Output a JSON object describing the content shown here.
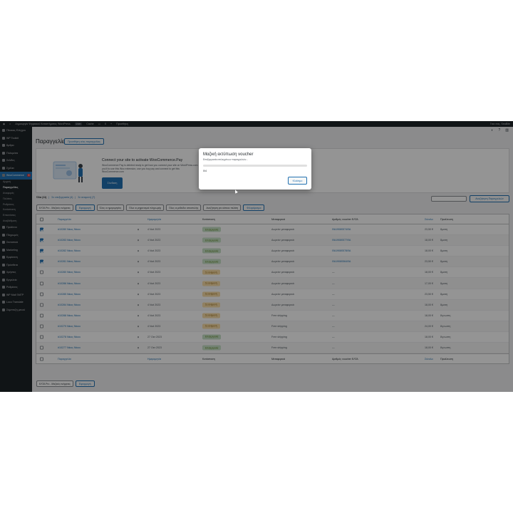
{
  "adminbar": {
    "site_name": "Δημιουργία Ψηφιακού Καταστήματος WordPress",
    "site_tag": "Live",
    "cache": "Cache",
    "comments_count": "0",
    "new": "Προσθήκη",
    "greeting": "Γεια σας, SeaBite"
  },
  "sidebar": {
    "items": [
      {
        "label": "Πίνακας Ελέγχου",
        "icon": "dashboard-icon"
      },
      {
        "label": "WP Toolkit",
        "icon": "toolkit-icon"
      },
      {
        "label": "Άρθρα",
        "icon": "pin-icon"
      },
      {
        "label": "Πολυμέσα",
        "icon": "media-icon"
      },
      {
        "label": "Σελίδες",
        "icon": "pages-icon"
      },
      {
        "label": "Σχόλια",
        "icon": "comments-icon"
      }
    ],
    "woo_label": "WooCommerce",
    "woo_badge": "4",
    "woo_subitems": [
      "Αρχική",
      "Παραγγελίες",
      "Αναφορές",
      "Πελάτες",
      "Ρυθμίσεις",
      "Κατάσταση",
      "Επεκτάσεις",
      "Αναβάθμιση"
    ],
    "woo_current": "Παραγγελίες",
    "items2": [
      {
        "label": "Προϊόντα",
        "icon": "products-icon"
      },
      {
        "label": "Πληρωμές",
        "icon": "payments-icon"
      },
      {
        "label": "Στατιστικά",
        "icon": "analytics-icon"
      },
      {
        "label": "Marketing",
        "icon": "marketing-icon"
      },
      {
        "label": "Εμφάνιση",
        "icon": "appearance-icon"
      },
      {
        "label": "Πρόσθετα",
        "icon": "plugins-icon"
      },
      {
        "label": "Χρήστες",
        "icon": "users-icon"
      },
      {
        "label": "Εργαλεία",
        "icon": "tools-icon"
      },
      {
        "label": "Ρυθμίσεις",
        "icon": "settings-icon"
      },
      {
        "label": "WP Mail SMTP",
        "icon": "mail-icon"
      },
      {
        "label": "Loco Translate",
        "icon": "translate-icon"
      },
      {
        "label": "Σύμπτυξη μενού",
        "icon": "collapse-icon"
      }
    ]
  },
  "page": {
    "title": "Παραγγελίες",
    "add_new": "Προσθήκη νέας παραγγελίας"
  },
  "promo": {
    "title": "Connect your site to activate WooCommerce.Pay",
    "desc": "WooCommerce Pay is deleted ready to get how you connect your site on WordPress.com you'll to use this Woo extension, use you buy pay and connect to get this WooCommerce.com",
    "button": "Σύνδεση"
  },
  "subsub": {
    "all": "Όλα (11)",
    "processing": "Σε επεξεργασία (4)",
    "on_hold": "Σε αναμονή (7)"
  },
  "search_button": "Αναζήτηση Παραγγελιών",
  "filters": {
    "bulk": "ΕΛΤΑ Pro - Μαζικές ενέργειες",
    "apply": "Εφαρμογή",
    "dates": "Όλες οι ημερομηνίες",
    "payment": "Όλοι οι μηχανισμοί πληρωμής",
    "methods": "Όλες οι μέθοδοι αποστολής",
    "customer": "Αναζήτηση για κάποιο πελάτη",
    "filter": "Φιλτράρισμα"
  },
  "table": {
    "headers": {
      "order": "Παραγγελία",
      "date": "Ημερομηνία",
      "status": "Κατάσταση",
      "shipping": "Μεταφορικά",
      "voucher": "Αριθμός voucher ΕΛΤΑ",
      "total": "Σύνολο",
      "origin": "Προέλευση"
    },
    "rows": [
      {
        "order": "#10280 Νίκος Νίκου",
        "date": "4 Νοέ 2023",
        "status": "Επεξεργασία",
        "status_kind": "processing",
        "shipping": "Δωρεάν μεταφορικά",
        "voucher": "ΘΑ19080574ΘΑ",
        "total": "23,50 €",
        "origin": "Άμεση",
        "checked": true
      },
      {
        "order": "#10283 Νίκος Νίκου",
        "date": "4 Νοέ 2023",
        "status": "Επεξεργασία",
        "status_kind": "processing",
        "shipping": "Δωρεάν μεταφορικά",
        "voucher": "ΘΑ19080577ΘΑ",
        "total": "18,00 €",
        "origin": "Άμεση",
        "checked": true
      },
      {
        "order": "#10282 Νίκος Νίκου",
        "date": "4 Νοέ 2023",
        "status": "Επεξεργασία",
        "status_kind": "processing",
        "shipping": "Δωρεάν μεταφορικά",
        "voucher": "ΘΑ19080578ΘΑ",
        "total": "18,00 €",
        "origin": "Άμεση",
        "checked": true
      },
      {
        "order": "#10281 Νίκος Νίκου",
        "date": "4 Νοέ 2023",
        "status": "Επεξεργασία",
        "status_kind": "processing",
        "shipping": "Δωρεάν μεταφορικά",
        "voucher": "ΘΑ19080564ΘΑ",
        "total": "23,50 €",
        "origin": "Άμεση",
        "checked": true
      },
      {
        "order": "#10280 Νίκος Νίκου",
        "date": "4 Νοέ 2023",
        "status": "Σε αναμονή",
        "status_kind": "hold",
        "shipping": "Δωρεάν μεταφορικά",
        "voucher": "—",
        "total": "18,00 €",
        "origin": "Άμεση",
        "checked": false
      },
      {
        "order": "#10286 Νίκος Νίκου",
        "date": "4 Νοέ 2023",
        "status": "Σε αναμονή",
        "status_kind": "hold",
        "shipping": "Δωρεάν μεταφορικά",
        "voucher": "—",
        "total": "17,00 €",
        "origin": "Άμεση",
        "checked": false
      },
      {
        "order": "#10285 Νίκος Νίκου",
        "date": "4 Νοέ 2023",
        "status": "Σε αναμονή",
        "status_kind": "hold",
        "shipping": "Δωρεάν μεταφορικά",
        "voucher": "—",
        "total": "23,50 €",
        "origin": "Άμεση",
        "checked": false
      },
      {
        "order": "#10284 Νίκος Νίκου",
        "date": "4 Νοέ 2023",
        "status": "Σε αναμονή",
        "status_kind": "hold",
        "shipping": "Δωρεάν μεταφορικά",
        "voucher": "—",
        "total": "18,00 €",
        "origin": "Άμεση",
        "checked": false
      },
      {
        "order": "#10288 Νίκος Νίκου",
        "date": "4 Νοέ 2023",
        "status": "Σε αναμονή",
        "status_kind": "hold",
        "shipping": "Free shipping",
        "voucher": "—",
        "total": "18,00 €",
        "origin": "Άγνωστη",
        "checked": false
      },
      {
        "order": "#10279 Νίκος Νίκου",
        "date": "4 Νοέ 2023",
        "status": "Σε αναμονή",
        "status_kind": "hold",
        "shipping": "Free shipping",
        "voucher": "—",
        "total": "24,00 €",
        "origin": "Άγνωστη",
        "checked": false
      },
      {
        "order": "#10278 Νίκος Νίκου",
        "date": "27 Οκτ 2023",
        "status": "Επεξεργασία",
        "status_kind": "processing",
        "shipping": "Free shipping",
        "voucher": "—",
        "total": "18,00 €",
        "origin": "Άγνωστη",
        "checked": false
      },
      {
        "order": "#10277 Νίκος Νίκου",
        "date": "27 Οκτ 2023",
        "status": "Επεξεργασία",
        "status_kind": "processing",
        "shipping": "Free shipping",
        "voucher": "—",
        "total": "18,00 €",
        "origin": "Άγνωστη",
        "checked": false
      }
    ]
  },
  "bottom": {
    "bulk": "ΕΛΤΑ Pro - Μαζικές ενέργειες",
    "apply": "Εφαρμογή"
  },
  "modal": {
    "title": "Μαζική εκτύπωση voucher",
    "subtitle": "Επεξεργασία επιλεγμένων παραγγελιών...",
    "progress_percent": 0,
    "progress_text": "0/4",
    "close": "Κλείσιμο"
  },
  "colors": {
    "accent": "#2271b1",
    "admin_dark": "#1d2327",
    "processing_bg": "#c6e1c6",
    "hold_bg": "#f8dda7"
  }
}
